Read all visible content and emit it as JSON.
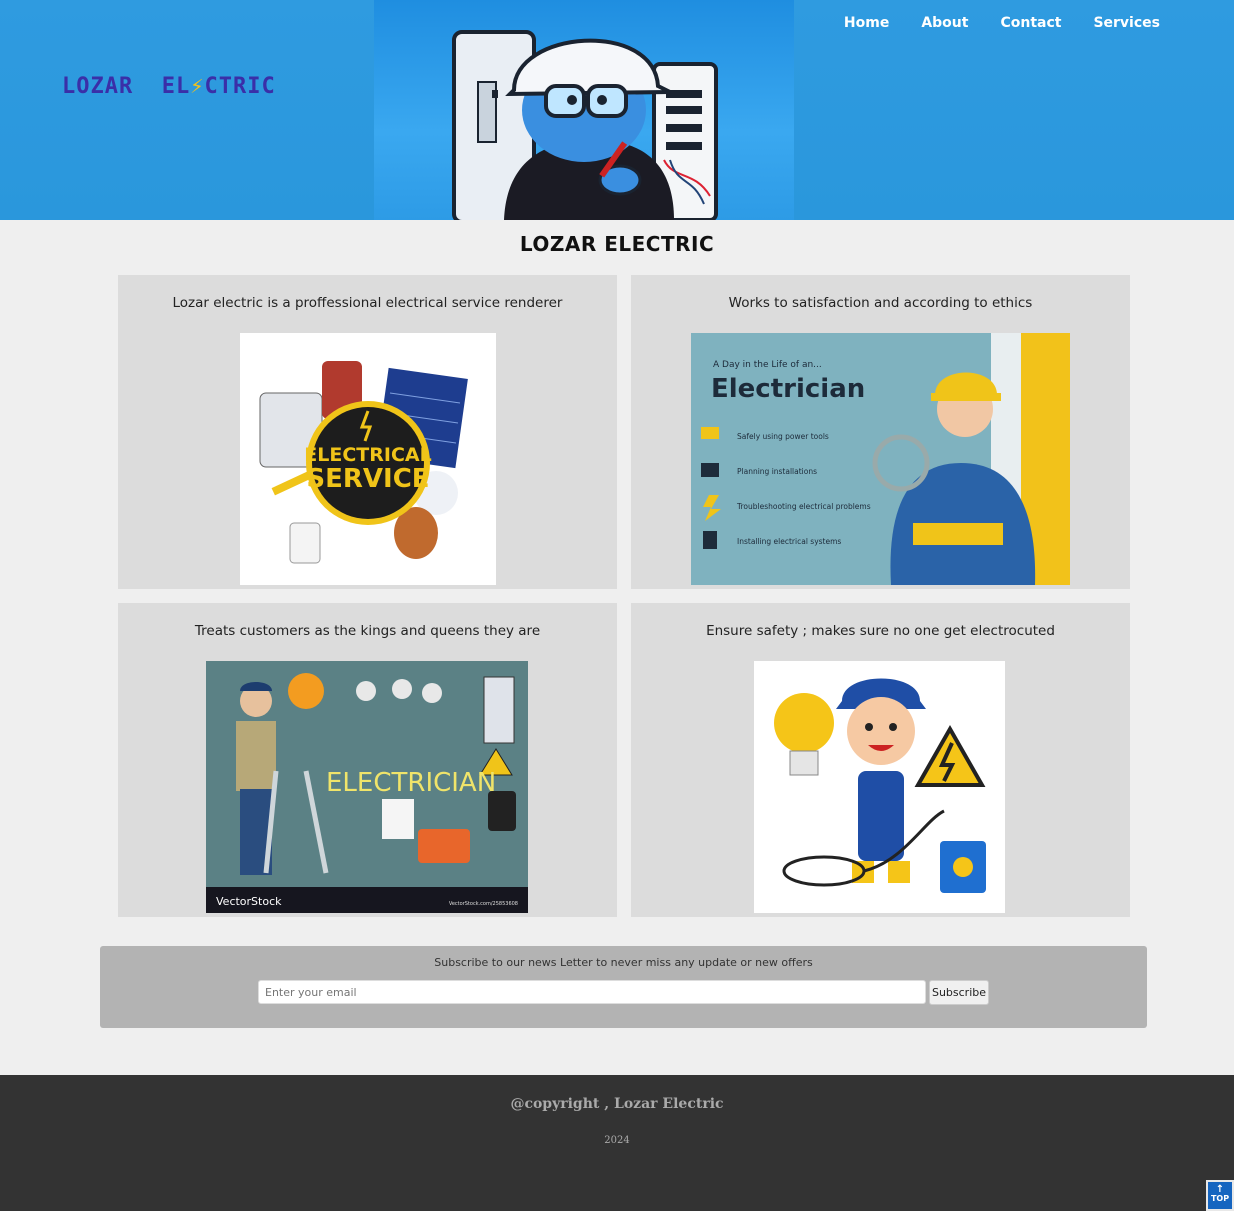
{
  "header": {
    "logo_left": "LOZAR",
    "logo_mid": "EL",
    "logo_bolt": "⚡",
    "logo_right": "CTRIC",
    "nav": [
      "Home",
      "About",
      "Contact",
      "Services"
    ]
  },
  "main": {
    "title": "LOZAR ELECTRIC",
    "cards": [
      {
        "caption": "Lozar electric is a proffessional electrical service renderer",
        "image_text_1": "ELECTRICAL",
        "image_text_2": "SERVICE"
      },
      {
        "caption": "Works to satisfaction and according to ethics",
        "image_small": "A Day in the Life of an...",
        "image_title": "Electrician",
        "image_items": [
          "Safely using power tools",
          "Planning installations",
          "Troubleshooting electrical problems",
          "Installing electrical systems"
        ]
      },
      {
        "caption": "Treats customers as the kings and queens they are",
        "image_text": "ELECTRICIAN",
        "image_brand": "VectorStock",
        "image_url": "VectorStock.com/25853608"
      },
      {
        "caption": "Ensure safety ; makes sure no one get electrocuted"
      }
    ]
  },
  "subscribe": {
    "message": "Subscribe to our news Letter to never miss any update or new offers",
    "placeholder": "Enter your email",
    "button": "Subscribe"
  },
  "footer": {
    "copyright": "@copyright , Lozar Electric",
    "year": "2024",
    "top_label": "TOP",
    "top_icon": "↑"
  },
  "colors": {
    "header": "#2f9be0",
    "logo": "#3a2fa8",
    "card_bg": "#dcdcdc",
    "footer_bg": "#333333"
  }
}
